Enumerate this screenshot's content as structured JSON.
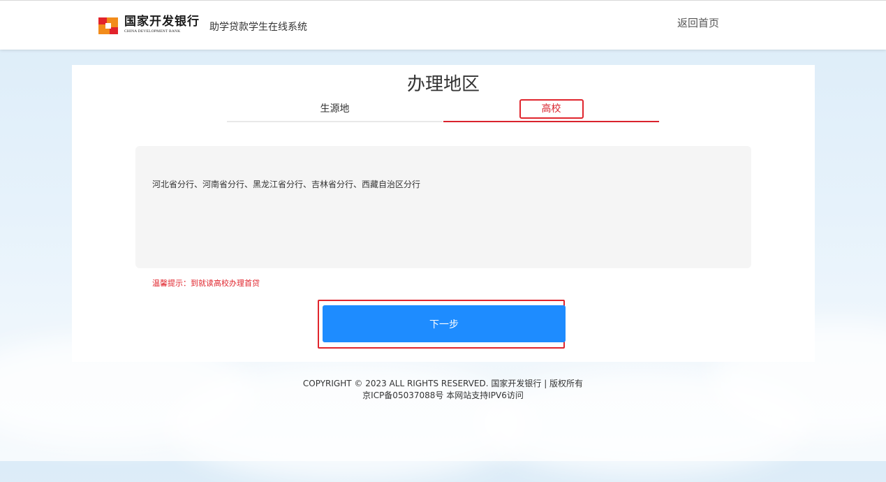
{
  "header": {
    "brand_cn": "国家开发银行",
    "brand_en": "CHINA DEVELOPMENT BANK",
    "system_name": "助学贷款学生在线系统",
    "home_link": "返回首页"
  },
  "main": {
    "title": "办理地区",
    "tabs": [
      {
        "label": "生源地",
        "active": false
      },
      {
        "label": "高校",
        "active": true
      }
    ],
    "regions_text": "河北省分行、河南省分行、黑龙江省分行、吉林省分行、西藏自治区分行",
    "tip": "温馨提示：到就读高校办理首贷",
    "next_button": "下一步"
  },
  "footer": {
    "copyright": "COPYRIGHT © 2023 ALL RIGHTS RESERVED. 国家开发银行 | 版权所有",
    "icp": "京ICP备05037088号 本网站支持IPV6访问"
  },
  "colors": {
    "accent_red": "#d9232d",
    "button_blue": "#1e8cff",
    "logo_orange": "#f28c1b"
  }
}
